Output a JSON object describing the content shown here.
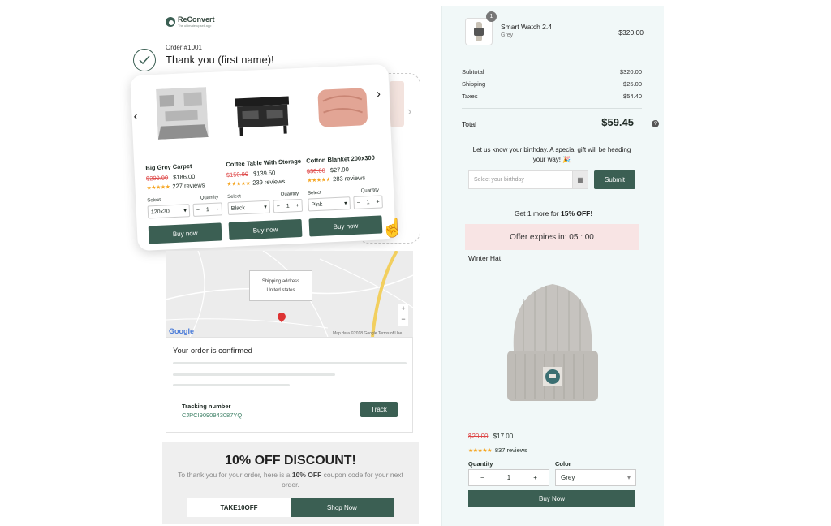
{
  "brand": {
    "name": "ReConvert",
    "tagline": "The ultimate upsell app"
  },
  "order": {
    "number": "Order #1001",
    "thanks": "Thank you (first name)!"
  },
  "carousel": {
    "products": [
      {
        "name": "Big Grey Carpet",
        "old_price": "$200.00",
        "price": "$186.00",
        "reviews": "227 reviews",
        "select_label": "Select",
        "quantity_label": "Quantity",
        "option": "120x30",
        "qty": "1",
        "buy": "Buy now"
      },
      {
        "name": "Coffee Table With Storage",
        "old_price": "$150.00",
        "price": "$139.50",
        "reviews": "239 reviews",
        "select_label": "Select",
        "quantity_label": "Quantity",
        "option": "Black",
        "qty": "1",
        "buy": "Buy now"
      },
      {
        "name": "Cotton Blanket 200x300",
        "old_price": "$30.00",
        "price": "$27.90",
        "reviews": "283 reviews",
        "select_label": "Select",
        "quantity_label": "Quantity",
        "option": "Pink",
        "qty": "1",
        "buy": "Buy now"
      }
    ]
  },
  "map": {
    "tooltip_line1": "Shipping address",
    "tooltip_line2": "United states",
    "google": "Google",
    "credit": "Map data ©2018 Google   Terms of Use"
  },
  "confirmation": {
    "title": "Your order is confirmed",
    "tracking_label": "Tracking number",
    "tracking_number": "CJPCI9090943087YQ",
    "track_button": "Track"
  },
  "discount": {
    "title": "10% OFF DISCOUNT!",
    "text_before": "To thank you for your order, here is a ",
    "text_bold": "10% OFF",
    "text_after": " coupon code for your next order.",
    "code": "TAKE10OFF",
    "shop_button": "Shop Now"
  },
  "summary": {
    "item": {
      "badge": "1",
      "name": "Smart Watch 2.4",
      "variant": "Grey",
      "price": "$320.00"
    },
    "subtotal_label": "Subtotal",
    "subtotal": "$320.00",
    "shipping_label": "Shipping",
    "shipping": "$25.00",
    "taxes_label": "Taxes",
    "taxes": "$54.40",
    "total_label": "Total",
    "total": "$59.45"
  },
  "birthday": {
    "prompt": "Let us know your birthday. A special gift will be heading your way! 🎉",
    "placeholder": "Select your birthday",
    "submit": "Submit"
  },
  "upsell": {
    "headline_before": "Get 1 more for ",
    "headline_bold": "15% OFF!",
    "offer_timer": "Offer expires in: 05 : 00",
    "product": "Winter Hat",
    "old_price": "$20.00",
    "price": "$17.00",
    "reviews": "837 reviews",
    "quantity_label": "Quantity",
    "color_label": "Color",
    "qty": "1",
    "color": "Grey",
    "buy": "Buy Now"
  },
  "colors": {
    "accent": "#3b5f53",
    "star": "#f5a623",
    "sale": "#dd4444"
  }
}
